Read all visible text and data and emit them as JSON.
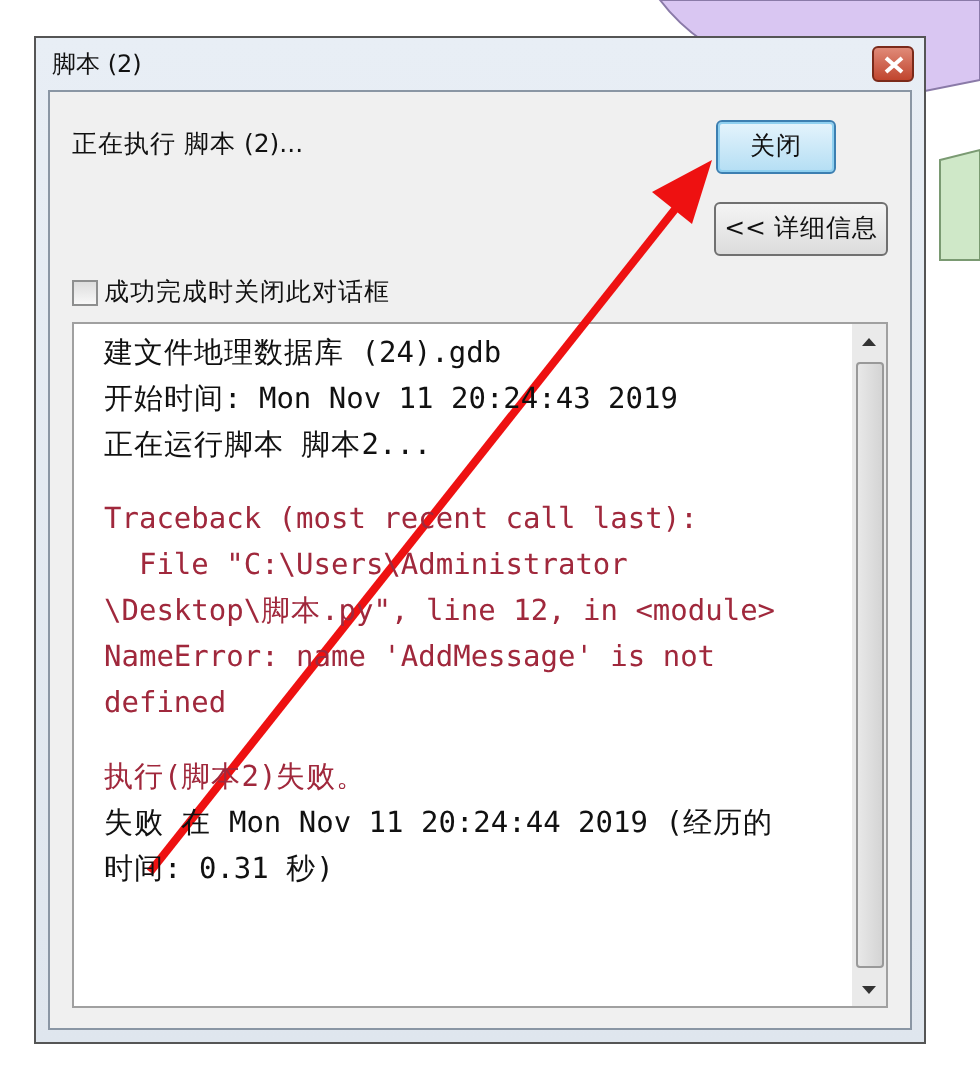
{
  "window": {
    "title": "脚本 (2)"
  },
  "status_text": "正在执行 脚本 (2)...",
  "buttons": [
    {
      "label": "关闭",
      "kind": "default"
    },
    {
      "label": "<< 详细信息",
      "kind": "normal"
    }
  ],
  "close_on_success": {
    "label": "成功完成时关闭此对话框",
    "checked": false
  },
  "log_blocks": [
    {
      "lines": [
        {
          "text": "建文件地理数据库 (24).gdb",
          "kind": "info"
        },
        {
          "text": "开始时间: Mon Nov 11 20:24:43 2019",
          "kind": "info"
        },
        {
          "text": "正在运行脚本 脚本2...",
          "kind": "info"
        }
      ]
    },
    {
      "lines": [
        {
          "text": "Traceback (most recent call last):",
          "kind": "error"
        },
        {
          "text": "  File \"C:\\Users\\Administrator",
          "kind": "error"
        },
        {
          "text": "\\Desktop\\脚本.py\", line 12, in <module>",
          "kind": "error"
        },
        {
          "text": "NameError: name 'AddMessage' is not",
          "kind": "error"
        },
        {
          "text": "defined",
          "kind": "error"
        }
      ]
    },
    {
      "lines": [
        {
          "text": "执行(脚本2)失败。",
          "kind": "error"
        },
        {
          "text": "失败 在 Mon Nov 11 20:24:44 2019 (经历的",
          "kind": "info"
        },
        {
          "text": "时间: 0.31 秒)",
          "kind": "info"
        }
      ]
    }
  ]
}
